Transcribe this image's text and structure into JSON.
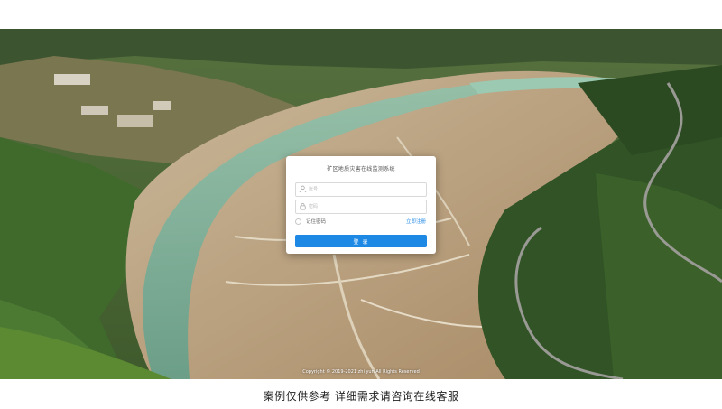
{
  "login": {
    "title": "矿区地质灾害在线监测系统",
    "username_placeholder": "账号",
    "password_placeholder": "密码",
    "remember_label": "记住密码",
    "register_link": "立即注册",
    "login_button": "登 录"
  },
  "footer": {
    "copyright": "Copyright © 2019-2021 zhi yun All Rights Reserved"
  },
  "caption": {
    "text": "案例仅供参考 详细需求请咨询在线客服"
  },
  "colors": {
    "primary": "#1e88e5",
    "card_bg": "#ffffff"
  },
  "icons": {
    "username": "user-icon",
    "password": "lock-icon"
  }
}
